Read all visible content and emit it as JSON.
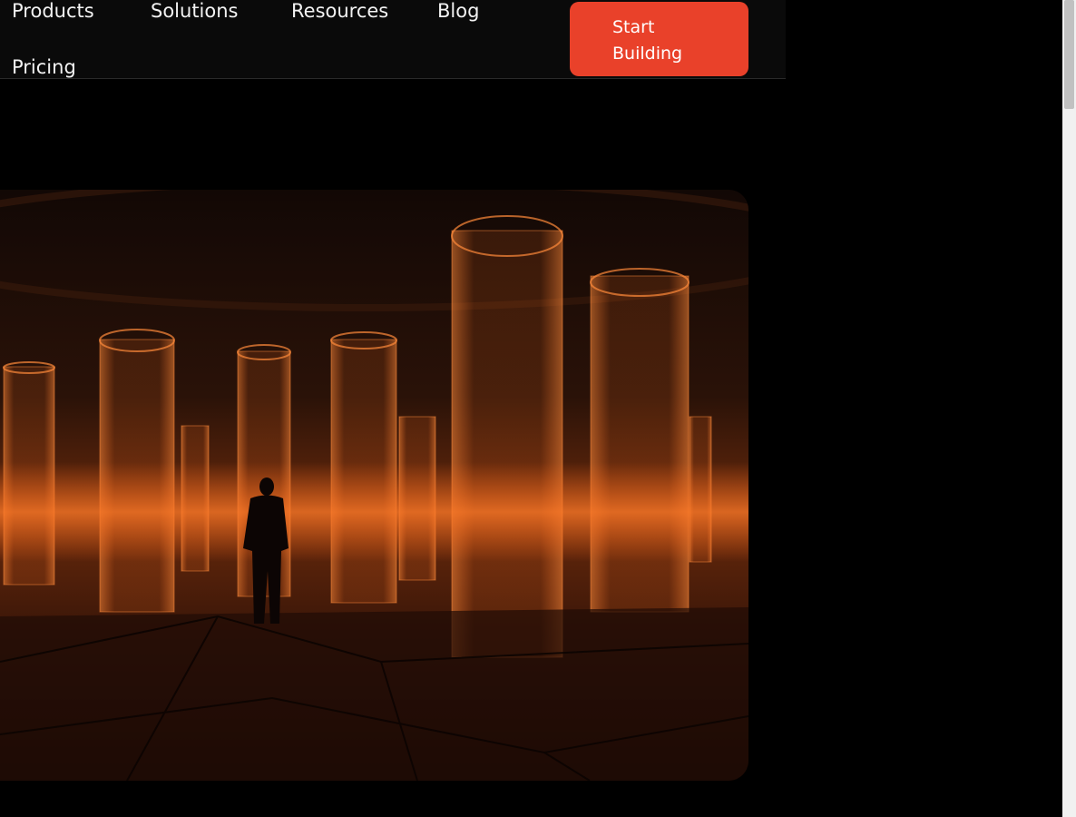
{
  "nav": {
    "links": [
      "Products",
      "Solutions",
      "Resources",
      "Blog",
      "Pricing"
    ],
    "cta_label": "Start Building"
  },
  "colors": {
    "accent": "#e9412a",
    "background": "#000000",
    "navbar": "#0a0a0a",
    "glow": "#ff6a1a"
  },
  "hero": {
    "image": "person-among-glowing-glass-cylinders"
  }
}
